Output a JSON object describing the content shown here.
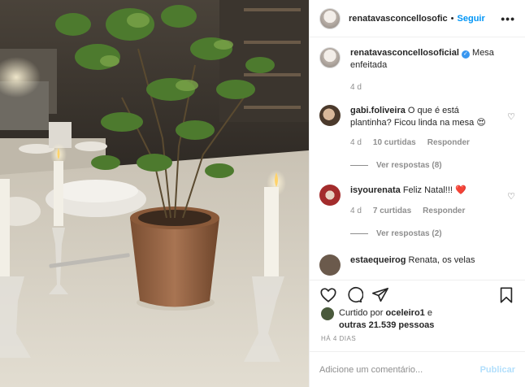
{
  "header": {
    "username": "renatavasconcellosofic",
    "separator": "•",
    "follow_label": "Seguir",
    "more_label": "•••"
  },
  "caption": {
    "username": "renatavasconcellosoficial",
    "text": "Mesa enfeitada",
    "time": "4 d"
  },
  "comments": [
    {
      "username": "gabi.foliveira",
      "text": "O que é está plantinha? Ficou linda na mesa 😍",
      "time": "4 d",
      "likes": "10 curtidas",
      "reply": "Responder",
      "view_replies": "Ver respostas (8)"
    },
    {
      "username": "isyourenata",
      "text": "Feliz Natal!!! ❤️",
      "time": "4 d",
      "likes": "7 curtidas",
      "reply": "Responder",
      "view_replies": "Ver respostas (2)"
    },
    {
      "username": "estaequeirog",
      "text": "Renata, os velas",
      "time": "",
      "likes": "",
      "reply": "",
      "view_replies": ""
    }
  ],
  "likes": {
    "prefix": "Curtido por",
    "user": "oceleiro1",
    "conj": "e",
    "others": "outras 21.539 pessoas"
  },
  "posted_ago": "HÁ 4 DIAS",
  "add_comment": {
    "placeholder": "Adicione um comentário...",
    "publish_label": "Publicar"
  },
  "icons": [
    "heart-icon",
    "comment-icon",
    "share-icon",
    "bookmark-icon"
  ]
}
